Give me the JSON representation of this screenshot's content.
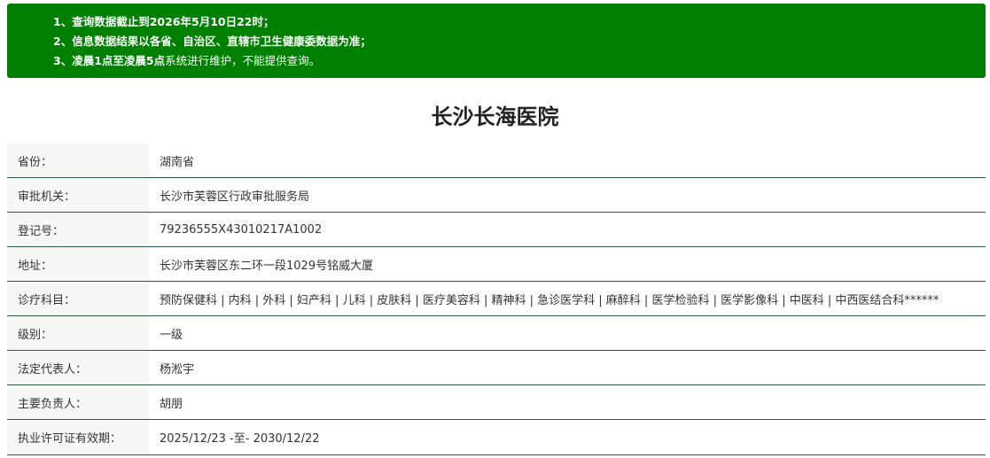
{
  "notice": {
    "line1": {
      "prefix": "1、查询数据截止到",
      "date": "2026年5月10日22时",
      "suffix": "；"
    },
    "line2": {
      "text": "2、信息数据结果以各省、自治区、直辖市卫生健康委数据为准；"
    },
    "line3": {
      "prefix": "3、凌晨1点至凌晨5点",
      "suffix": "系统进行维护，不能提供查询。"
    }
  },
  "hospital": {
    "name": "长沙长海医院"
  },
  "details": [
    {
      "label": "省份：",
      "value": "湖南省"
    },
    {
      "label": "审批机关：",
      "value": "长沙市芙蓉区行政审批服务局"
    },
    {
      "label": "登记号：",
      "value": "79236555X43010217A1002"
    },
    {
      "label": "地址：",
      "value": "长沙市芙蓉区东二环一段1029号铭威大厦"
    },
    {
      "label": "诊疗科目：",
      "value": "预防保健科 | 内科 | 外科 | 妇产科 | 儿科 | 皮肤科 | 医疗美容科 | 精神科 | 急诊医学科 | 麻醉科 | 医学检验科 | 医学影像科 | 中医科 | 中西医结合科******"
    },
    {
      "label": "级别：",
      "value": "一级"
    },
    {
      "label": "法定代表人：",
      "value": "杨淞宇"
    },
    {
      "label": "主要负责人：",
      "value": "胡朋"
    },
    {
      "label": "执业许可证有效期：",
      "value": "2025/12/23 -至- 2030/12/22"
    }
  ],
  "colors": {
    "notice_bg": "#008000",
    "row_border": "#2f5a44",
    "label_bg": "#f7f7f7"
  }
}
